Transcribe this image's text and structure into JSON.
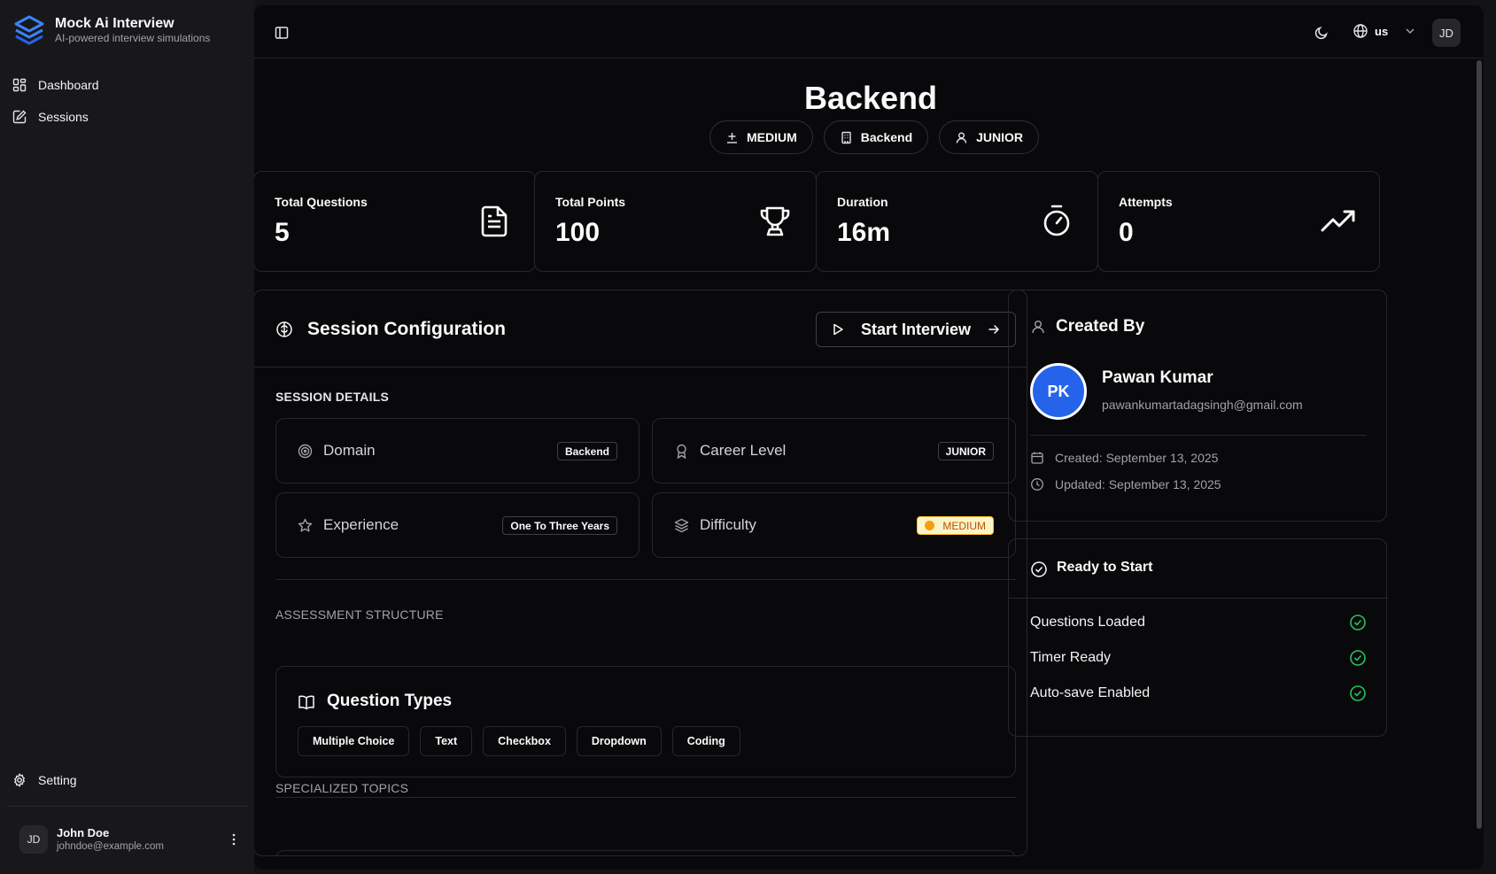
{
  "brand": {
    "title": "Mock Ai Interview",
    "subtitle": "AI-powered interview simulations"
  },
  "sidebar": {
    "nav": [
      {
        "label": "Dashboard",
        "icon": "dashboard-icon"
      },
      {
        "label": "Sessions",
        "icon": "sessions-icon"
      }
    ],
    "setting": {
      "label": "Setting",
      "icon": "gear-icon"
    },
    "user": {
      "initials": "JD",
      "name": "John Doe",
      "email": "johndoe@example.com"
    }
  },
  "topbar": {
    "language": "us",
    "avatar_initials": "JD"
  },
  "page": {
    "title": "Backend",
    "pills": [
      {
        "label": "MEDIUM",
        "icon": "difficulty-icon"
      },
      {
        "label": "Backend",
        "icon": "building-icon"
      },
      {
        "label": "JUNIOR",
        "icon": "user-icon"
      }
    ]
  },
  "stats": [
    {
      "label": "Total Questions",
      "value": "5",
      "icon": "document-icon"
    },
    {
      "label": "Total Points",
      "value": "100",
      "icon": "trophy-icon"
    },
    {
      "label": "Duration",
      "value": "16m",
      "icon": "timer-icon"
    },
    {
      "label": "Attempts",
      "value": "0",
      "icon": "trending-up-icon"
    }
  ],
  "config": {
    "title": "Session Configuration",
    "start_label": "Start Interview",
    "session_details_label": "SESSION DETAILS",
    "details": [
      {
        "label": "Domain",
        "value": "Backend",
        "icon": "target-icon"
      },
      {
        "label": "Career Level",
        "value": "JUNIOR",
        "icon": "award-icon"
      },
      {
        "label": "Experience",
        "value": "One To Three Years",
        "icon": "star-icon"
      },
      {
        "label": "Difficulty",
        "value": "MEDIUM",
        "icon": "layers-icon"
      }
    ],
    "assessment_label": "ASSESSMENT STRUCTURE",
    "question_types_title": "Question Types",
    "question_types": [
      "Multiple Choice",
      "Text",
      "Checkbox",
      "Dropdown",
      "Coding"
    ],
    "specialized_label": "SPECIALIZED TOPICS"
  },
  "created_by": {
    "title": "Created By",
    "initials": "PK",
    "name": "Pawan Kumar",
    "email": "pawankumartadagsingh@gmail.com",
    "created": "Created: September 13, 2025",
    "updated": "Updated: September 13, 2025"
  },
  "ready": {
    "title": "Ready to Start",
    "items": [
      "Questions Loaded",
      "Timer Ready",
      "Auto-save Enabled"
    ]
  },
  "colors": {
    "accent_blue": "#2563eb",
    "success": "#22c55e",
    "medium_badge_bg": "#fef3c7",
    "medium_badge_text": "#b45309"
  }
}
